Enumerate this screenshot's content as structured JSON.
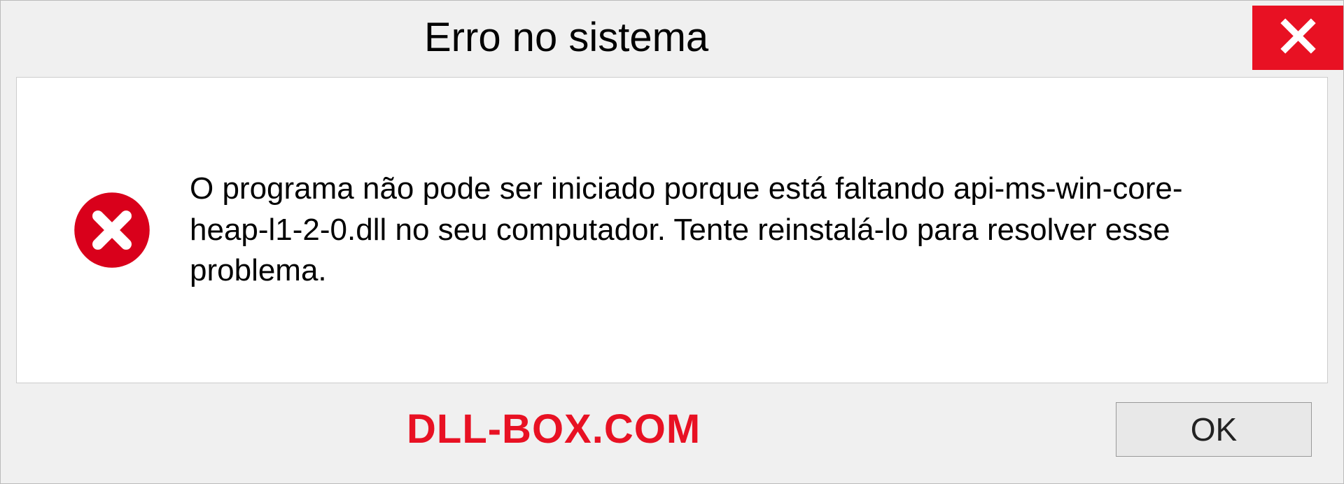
{
  "dialog": {
    "title": "Erro no sistema",
    "message": "O programa não pode ser iniciado porque está faltando api-ms-win-core-heap-l1-2-0.dll no seu computador. Tente reinstalá-lo para resolver esse problema.",
    "ok_label": "OK",
    "watermark": "DLL-BOX.COM",
    "colors": {
      "close_red": "#e81123",
      "error_red": "#d9001b",
      "watermark_red": "#e81123"
    }
  }
}
